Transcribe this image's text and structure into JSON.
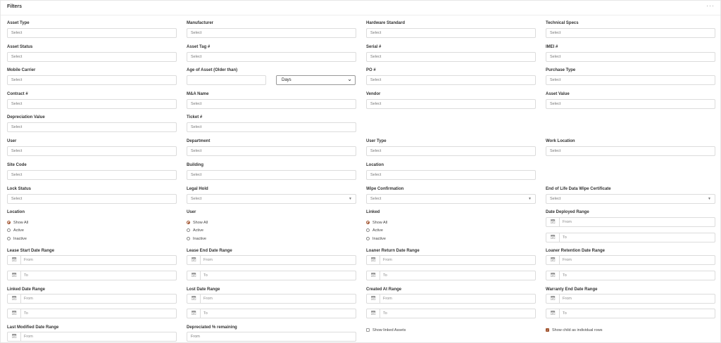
{
  "panel": {
    "title": "Filters",
    "more_glyph": "···"
  },
  "fields": {
    "asset_type": {
      "label": "Asset Type",
      "placeholder": "Select"
    },
    "manufacturer": {
      "label": "Manufacturer",
      "placeholder": "Select"
    },
    "hardware_standard": {
      "label": "Hardware Standard",
      "placeholder": "Select"
    },
    "technical_specs": {
      "label": "Technical Specs",
      "placeholder": "Select"
    },
    "asset_status": {
      "label": "Asset Status",
      "placeholder": "Select"
    },
    "asset_tag": {
      "label": "Asset Tag #",
      "placeholder": "Select"
    },
    "serial": {
      "label": "Serial #",
      "placeholder": "Select"
    },
    "imei": {
      "label": "IMEI #",
      "placeholder": "Select"
    },
    "mobile_carrier": {
      "label": "Mobile Carrier",
      "placeholder": "Select"
    },
    "age_of_asset": {
      "label": "Age of Asset (Older than)",
      "value": "",
      "unit": "Days"
    },
    "po": {
      "label": "PO #",
      "placeholder": "Select"
    },
    "purchase_type": {
      "label": "Purchase Type",
      "placeholder": "Select"
    },
    "contract": {
      "label": "Contract #",
      "placeholder": "Select"
    },
    "ma_name": {
      "label": "M&A Name",
      "placeholder": "Select"
    },
    "vendor": {
      "label": "Vendor",
      "placeholder": "Select"
    },
    "asset_value": {
      "label": "Asset Value",
      "placeholder": "Select"
    },
    "depreciation_value": {
      "label": "Depreciation Value",
      "placeholder": "Select"
    },
    "ticket": {
      "label": "Ticket #",
      "placeholder": "Select"
    },
    "user": {
      "label": "User",
      "placeholder": "Select"
    },
    "department": {
      "label": "Department",
      "placeholder": "Select"
    },
    "user_type": {
      "label": "User Type",
      "placeholder": "Select"
    },
    "work_location": {
      "label": "Work Location",
      "placeholder": "Select"
    },
    "site_code": {
      "label": "Site Code",
      "placeholder": "Select"
    },
    "building": {
      "label": "Building",
      "placeholder": "Select"
    },
    "location": {
      "label": "Location",
      "placeholder": "Select"
    },
    "lock_status": {
      "label": "Lock Status",
      "placeholder": "Select"
    },
    "legal_hold": {
      "label": "Legal Hold",
      "placeholder": "Select"
    },
    "wipe_confirmation": {
      "label": "Wipe Confirmation",
      "placeholder": "Select"
    },
    "eol_wipe_cert": {
      "label": "End of Life Data Wipe Certificate",
      "placeholder": "Select"
    },
    "depreciated_pct": {
      "label": "Depreciated % remaining",
      "placeholder": "From"
    }
  },
  "radio_groups": {
    "location": {
      "label": "Location",
      "options": [
        "Show All",
        "Active",
        "Inactive"
      ],
      "selected": "Show All"
    },
    "user": {
      "label": "User",
      "options": [
        "Show All",
        "Active",
        "Inactive"
      ],
      "selected": "Show All"
    },
    "linked": {
      "label": "Linked",
      "options": [
        "Show All",
        "Active",
        "Inactive"
      ],
      "selected": "Show All"
    }
  },
  "date_ranges": {
    "date_deployed": {
      "label": "Date Deployed Range",
      "from": "From",
      "to": "To"
    },
    "lease_start": {
      "label": "Lease Start Date Range",
      "from": "From",
      "to": "To"
    },
    "lease_end": {
      "label": "Lease End Date Range",
      "from": "From",
      "to": "To"
    },
    "loaner_return": {
      "label": "Loaner Return Date Range",
      "from": "From",
      "to": "To"
    },
    "loaner_retention": {
      "label": "Loaner Retention Date Range",
      "from": "From",
      "to": "To"
    },
    "linked_date": {
      "label": "Linked Date Range",
      "from": "From",
      "to": "To"
    },
    "lost_date": {
      "label": "Lost Date Range",
      "from": "From",
      "to": "To"
    },
    "created_at": {
      "label": "Created At Range",
      "from": "From",
      "to": "To"
    },
    "warranty_end": {
      "label": "Warranty End Date Range",
      "from": "From",
      "to": "To"
    },
    "last_modified": {
      "label": "Last Modified Date Range",
      "from": "From"
    }
  },
  "checkboxes": {
    "show_linked": {
      "label": "Show linked Assets",
      "checked": false
    },
    "show_child": {
      "label": "Show child as individual rows",
      "checked": true
    }
  },
  "icons": {
    "calendar": "calendar-icon",
    "caret": "caret-down-icon"
  },
  "colors": {
    "accent": "#a0522d",
    "border": "#dcdcdc",
    "label": "#333333"
  }
}
